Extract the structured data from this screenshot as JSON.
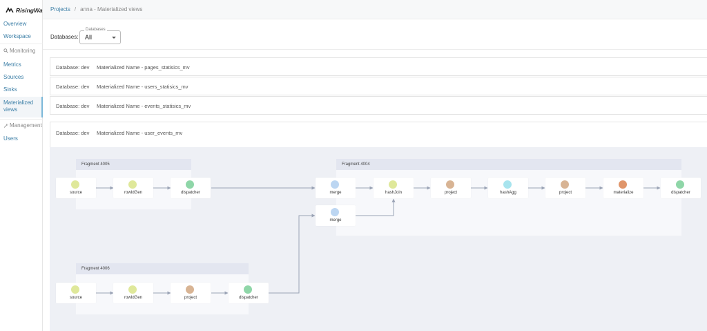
{
  "app": {
    "logo_text": "RisingWave"
  },
  "sidebar": {
    "items": [
      {
        "id": "overview",
        "label": "Overview"
      },
      {
        "id": "workspace",
        "label": "Workspace"
      },
      {
        "id": "metrics",
        "label": "Metrics"
      },
      {
        "id": "sources",
        "label": "Sources"
      },
      {
        "id": "sinks",
        "label": "Sinks"
      },
      {
        "id": "materialized",
        "label": "Materialized views",
        "active": true
      },
      {
        "id": "users",
        "label": "Users"
      }
    ],
    "sections": {
      "monitoring": "Monitoring",
      "management": "Management"
    }
  },
  "breadcrumb": {
    "root": "Projects",
    "separator": "/",
    "current": "anna - Materialized views"
  },
  "database_filter": {
    "label": "Databases:",
    "legend": "Databases",
    "value": "All"
  },
  "materialized_views": [
    {
      "database": "Database: dev",
      "name": "Materialized Name - pages_statisics_mv"
    },
    {
      "database": "Database: dev",
      "name": "Materialized Name - users_statisics_mv"
    },
    {
      "database": "Database: dev",
      "name": "Materialized Name - events_statisics_mv"
    },
    {
      "database": "Database: dev",
      "name": "Materialized Name - user_events_mv",
      "expanded": true
    }
  ],
  "fragments": {
    "f4005": {
      "title": "Fragment 4005"
    },
    "f4004": {
      "title": "Fragment 4004"
    },
    "f4006": {
      "title": "Fragment 4006"
    }
  },
  "nodes": {
    "a_source": {
      "label": "source",
      "color": "#dfe89a"
    },
    "a_rowidgen": {
      "label": "rowIdGen",
      "color": "#dfe89a"
    },
    "a_dispatcher": {
      "label": "dispatcher",
      "color": "#8fd6a8"
    },
    "b_merge1": {
      "label": "merge",
      "color": "#bcd6f2"
    },
    "b_merge2": {
      "label": "merge",
      "color": "#bcd6f2"
    },
    "b_hashjoin": {
      "label": "hashJoin",
      "color": "#dfe89a"
    },
    "b_project1": {
      "label": "project",
      "color": "#d8b494"
    },
    "b_hashagg": {
      "label": "hashAgg",
      "color": "#a8e4ee"
    },
    "b_project2": {
      "label": "project",
      "color": "#d8b494"
    },
    "b_materialize": {
      "label": "materialize",
      "color": "#e0956a"
    },
    "b_dispatcher": {
      "label": "dispatcher",
      "color": "#8fd6a8"
    },
    "c_source": {
      "label": "source",
      "color": "#dfe89a"
    },
    "c_rowidgen": {
      "label": "rowIdGen",
      "color": "#dfe89a"
    },
    "c_project": {
      "label": "project",
      "color": "#d8b494"
    },
    "c_dispatcher": {
      "label": "dispatcher",
      "color": "#8fd6a8"
    }
  }
}
